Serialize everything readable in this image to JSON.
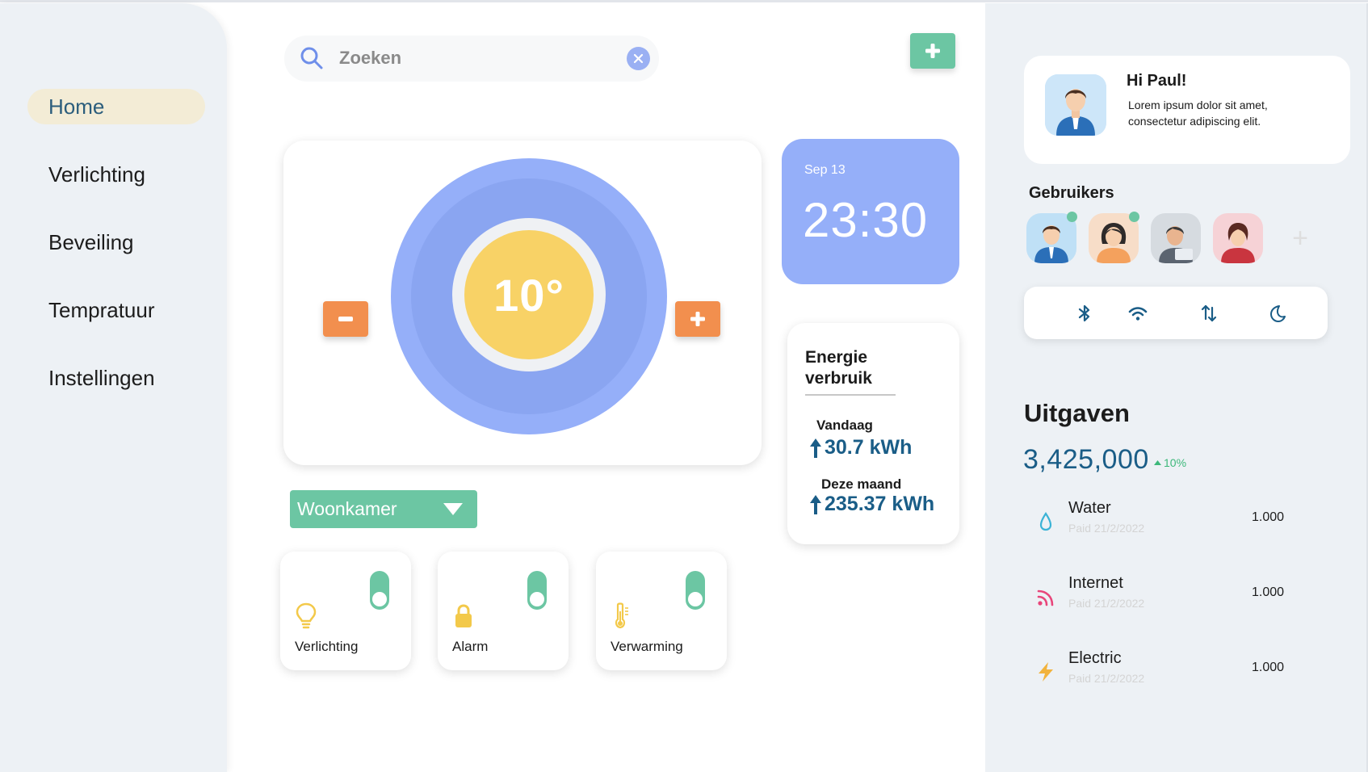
{
  "sidebar": {
    "items": [
      {
        "label": "Home",
        "active": true
      },
      {
        "label": "Verlichting"
      },
      {
        "label": "Beveiling"
      },
      {
        "label": "Tempratuur"
      },
      {
        "label": "Instellingen"
      }
    ]
  },
  "search": {
    "placeholder": "Zoeken",
    "value": ""
  },
  "thermostat": {
    "temperature": "10°"
  },
  "clock": {
    "date": "Sep 13",
    "time": "23:30"
  },
  "energy": {
    "title": "Energie verbruik",
    "today_label": "Vandaag",
    "today_value": "30.7 kWh",
    "month_label": "Deze maand",
    "month_value": "235.37 kWh"
  },
  "room": {
    "selected": "Woonkamer"
  },
  "devices": [
    {
      "label": "Verlichting",
      "icon": "bulb-icon",
      "on": true
    },
    {
      "label": "Alarm",
      "icon": "lock-icon",
      "on": true
    },
    {
      "label": "Verwarming",
      "icon": "thermometer-icon",
      "on": true
    }
  ],
  "greeting": {
    "title": "Hi Paul!",
    "text": "Lorem ipsum dolor sit amet, consectetur adipiscing elit."
  },
  "users": {
    "title": "Gebruikers"
  },
  "quick_toggles": [
    "bluetooth-icon",
    "wifi-icon",
    "data-transfer-icon",
    "moon-icon"
  ],
  "expenses": {
    "title": "Uitgaven",
    "total": "3,425,000",
    "change": "10%",
    "items": [
      {
        "name": "Water",
        "date": "Paid 21/2/2022",
        "amount": "1.000",
        "icon": "water-drop-icon"
      },
      {
        "name": "Internet",
        "date": "Paid 21/2/2022",
        "amount": "1.000",
        "icon": "rss-icon"
      },
      {
        "name": "Electric",
        "date": "Paid 21/2/2022",
        "amount": "1.000",
        "icon": "lightning-icon"
      }
    ]
  },
  "colors": {
    "accent_green": "#6cc6a3",
    "accent_blue": "#95aff9",
    "accent_orange": "#f28f4e",
    "sun_yellow": "#f8d266",
    "navy_text": "#1a5d87"
  }
}
